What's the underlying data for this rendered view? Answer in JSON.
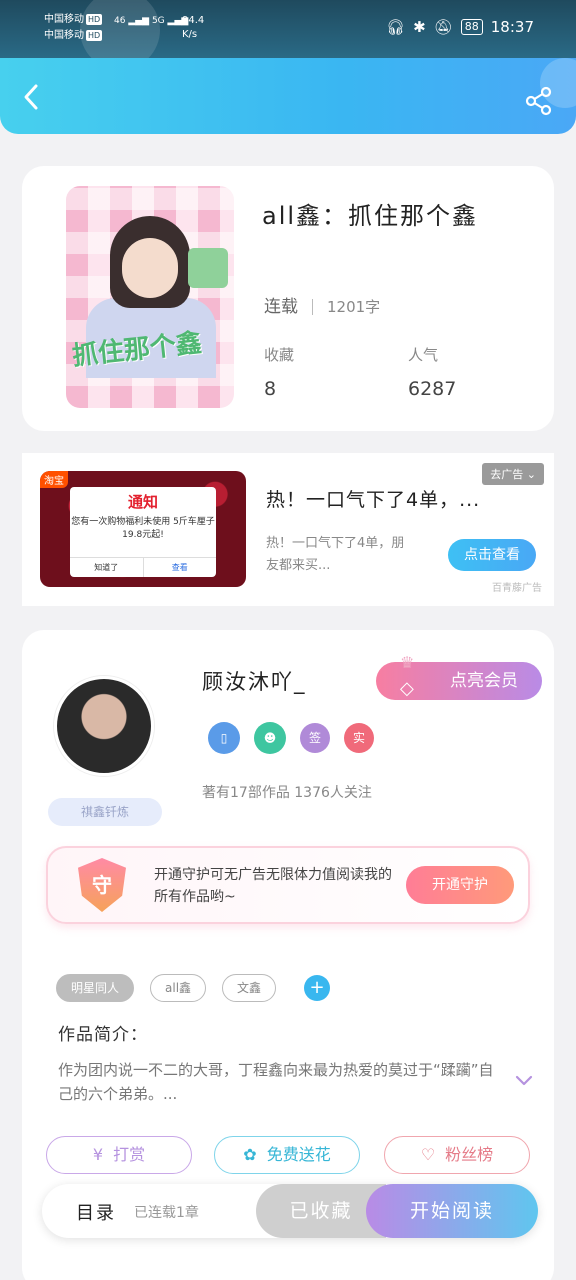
{
  "status_bar": {
    "carrier1": "中国移动",
    "carrier2": "中国移动",
    "hd": "HD",
    "net1": "46",
    "net2": "5G",
    "speed_value": "94.4",
    "speed_unit": "K/s",
    "battery": "88",
    "time": "18:37"
  },
  "header": {
    "back_icon": "back-arrow-icon",
    "share_icon": "share-icon"
  },
  "book": {
    "title": "all鑫：抓住那个鑫",
    "cover_art_text": "抓住那个鑫",
    "status": "连载",
    "words": "1201字",
    "favorites_label": "收藏",
    "favorites_value": "8",
    "popularity_label": "人气",
    "popularity_value": "6287"
  },
  "ad": {
    "badge": "淘宝",
    "popup_title": "通知",
    "popup_body": "您有一次购物福利未使用 5斤车厘子19.8元起!",
    "popup_btn_left": "知道了",
    "popup_btn_right": "查看",
    "remove_label": "去广告 ⌄",
    "title": "热！一口气下了4单，...",
    "description": "热！一口气下了4单，朋友都来买...",
    "cta": "点击查看",
    "source": "百青藤广告"
  },
  "author": {
    "name": "顾汝沐吖_",
    "fan_badge": "祺鑫钎炼",
    "vip_button": "点亮会员",
    "badges": [
      "▯",
      "☻",
      "签",
      "实"
    ],
    "stats": "著有17部作品 1376人关注",
    "guard_text": "开通守护可无广告无限体力值阅读我的所有作品哟~",
    "guard_icon_text": "守",
    "guard_button": "开通守护"
  },
  "tags": [
    "明星同人",
    "all鑫",
    "文鑫"
  ],
  "intro": {
    "label": "作品简介：",
    "text": "作为团内说一不二的大哥，丁程鑫向来最为热爱的莫过于“蹂躏”自己的六个弟弟。..."
  },
  "actions": {
    "reward": "打赏",
    "flower": "免费送花",
    "fans": "粉丝榜"
  },
  "bottom": {
    "toc": "目录",
    "toc_status": "已连载1章",
    "collected": "已收藏",
    "read": "开始阅读"
  },
  "colors": {
    "header_start": "#47d0ee",
    "header_end": "#4aa8f6",
    "vip_start": "#f77ea1",
    "vip_end": "#b98be6"
  }
}
